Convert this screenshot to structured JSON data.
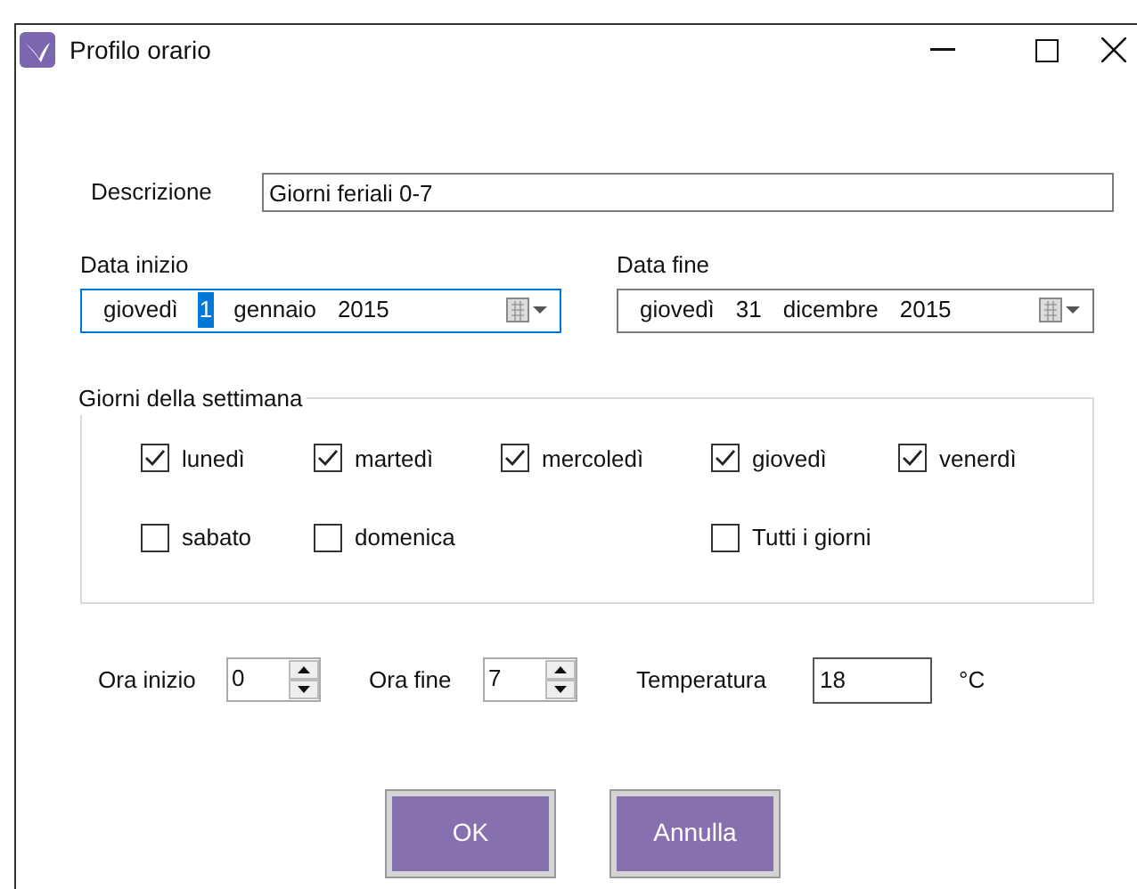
{
  "window": {
    "title": "Profilo orario"
  },
  "description": {
    "label": "Descrizione",
    "value": "Giorni feriali 0-7"
  },
  "date_start": {
    "label": "Data inizio",
    "focused": true,
    "segments": [
      {
        "text": "giovedì",
        "selected": false
      },
      {
        "text": "1",
        "selected": true
      },
      {
        "text": "gennaio",
        "selected": false
      },
      {
        "text": "2015",
        "selected": false
      }
    ]
  },
  "date_end": {
    "label": "Data fine",
    "focused": false,
    "segments": [
      {
        "text": "giovedì",
        "selected": false
      },
      {
        "text": "31",
        "selected": false
      },
      {
        "text": "dicembre",
        "selected": false
      },
      {
        "text": "2015",
        "selected": false
      }
    ]
  },
  "weekdays": {
    "title": "Giorni della settimana",
    "days": [
      {
        "label": "lunedì",
        "checked": true
      },
      {
        "label": "martedì",
        "checked": true
      },
      {
        "label": "mercoledì",
        "checked": true
      },
      {
        "label": "giovedì",
        "checked": true
      },
      {
        "label": "venerdì",
        "checked": true
      },
      {
        "label": "sabato",
        "checked": false
      },
      {
        "label": "domenica",
        "checked": false
      }
    ],
    "all_days": {
      "label": "Tutti i giorni",
      "checked": false
    }
  },
  "start_hour": {
    "label": "Ora inizio",
    "value": "0"
  },
  "end_hour": {
    "label": "Ora fine",
    "value": "7"
  },
  "temperature": {
    "label": "Temperatura",
    "value": "18",
    "unit": "°C"
  },
  "buttons": [
    "OK",
    "Annulla"
  ]
}
